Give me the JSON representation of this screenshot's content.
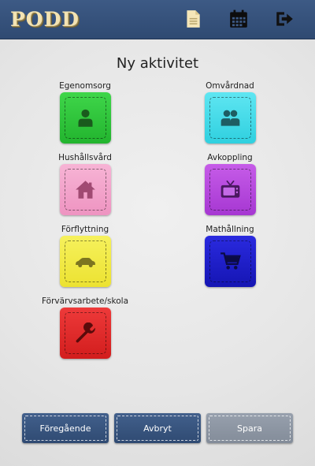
{
  "app": {
    "logo": "PODD"
  },
  "header": {
    "icons": [
      "document-icon",
      "calendar-icon",
      "logout-icon"
    ]
  },
  "page": {
    "title": "Ny aktivitet"
  },
  "activities": [
    {
      "label": "Egenomsorg",
      "color": "#2fc43a",
      "icon": "person-icon"
    },
    {
      "label": "Omvårdnad",
      "color": "#3fdbe8",
      "icon": "people-icon"
    },
    {
      "label": "Hushållsvård",
      "color": "#f2a4cb",
      "icon": "house-icon"
    },
    {
      "label": "Avkoppling",
      "color": "#b548dd",
      "icon": "tv-icon"
    },
    {
      "label": "Förflyttning",
      "color": "#f2ea45",
      "icon": "car-icon"
    },
    {
      "label": "Mathållning",
      "color": "#1f1fca",
      "icon": "cart-icon"
    },
    {
      "label": "Förvärvsarbete/skola",
      "color": "#e02a2a",
      "icon": "wrench-icon"
    }
  ],
  "footer": {
    "previous": "Föregående",
    "cancel": "Avbryt",
    "save": "Spara"
  }
}
